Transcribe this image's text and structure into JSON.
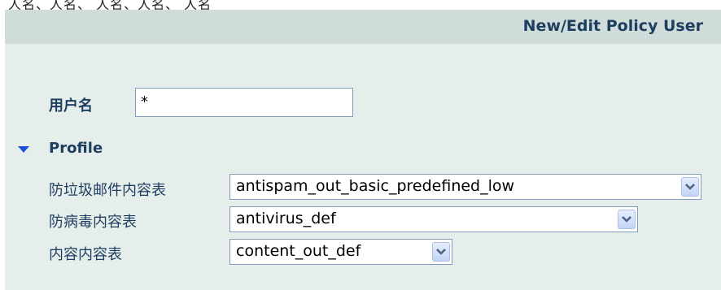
{
  "window": {
    "top_caption": "人名、人名、 人名、人名、 人名"
  },
  "header": {
    "title": "New/Edit Policy User"
  },
  "form": {
    "username_label": "用户名",
    "username_value": "*",
    "profile_section_label": "Profile",
    "rows": [
      {
        "label": "防垃圾邮件内容表",
        "selected": "antispam_out_basic_predefined_low"
      },
      {
        "label": "防病毒内容表",
        "selected": "antivirus_def"
      },
      {
        "label": "内容内容表",
        "selected": "content_out_def"
      }
    ]
  },
  "colors": {
    "header_bg": "#cfdcd9",
    "panel_bg": "#e6eeec",
    "label_text": "#1d3e5e",
    "section_toggle": "#1f4fd8"
  },
  "icons": {
    "section_toggle": "triangle-down-icon",
    "dropdown": "chevron-down-icon"
  }
}
